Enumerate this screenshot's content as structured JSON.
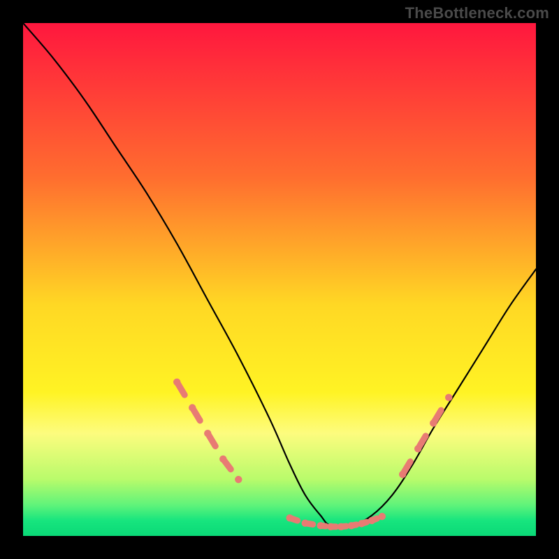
{
  "watermark": "TheBottleneck.com",
  "chart_data": {
    "type": "line",
    "title": "",
    "xlabel": "",
    "ylabel": "",
    "xlim": [
      0,
      100
    ],
    "ylim": [
      0,
      100
    ],
    "series": [
      {
        "name": "bottleneck-curve",
        "x": [
          0,
          6,
          12,
          18,
          24,
          30,
          36,
          42,
          48,
          52,
          55,
          58,
          60,
          64,
          68,
          72,
          76,
          80,
          85,
          90,
          95,
          100
        ],
        "y": [
          100,
          93,
          85,
          76,
          67,
          57,
          46,
          35,
          23,
          14,
          8,
          4,
          2,
          2,
          4,
          8,
          14,
          21,
          29,
          37,
          45,
          52
        ]
      }
    ],
    "highlight_segments": [
      {
        "name": "left-descent-pink",
        "x": [
          30,
          33,
          36,
          39,
          42
        ],
        "y": [
          30,
          25,
          20,
          15,
          11
        ]
      },
      {
        "name": "trough-pink",
        "x": [
          52,
          55,
          58,
          60,
          62,
          64,
          66,
          68,
          70
        ],
        "y": [
          3.5,
          2.5,
          2,
          1.8,
          1.8,
          2,
          2.4,
          3,
          3.8
        ]
      },
      {
        "name": "right-ascent-pink",
        "x": [
          74,
          77,
          80,
          83
        ],
        "y": [
          12,
          17,
          22,
          27
        ]
      }
    ],
    "gradient_stops": [
      {
        "pos": 0,
        "color": "#ff173e"
      },
      {
        "pos": 30,
        "color": "#ff6d2f"
      },
      {
        "pos": 55,
        "color": "#ffd824"
      },
      {
        "pos": 72,
        "color": "#fff324"
      },
      {
        "pos": 80,
        "color": "#fdfc7e"
      },
      {
        "pos": 89,
        "color": "#b8fb6b"
      },
      {
        "pos": 94,
        "color": "#5ff37a"
      },
      {
        "pos": 97,
        "color": "#17e57e"
      },
      {
        "pos": 100,
        "color": "#0ad977"
      }
    ]
  }
}
